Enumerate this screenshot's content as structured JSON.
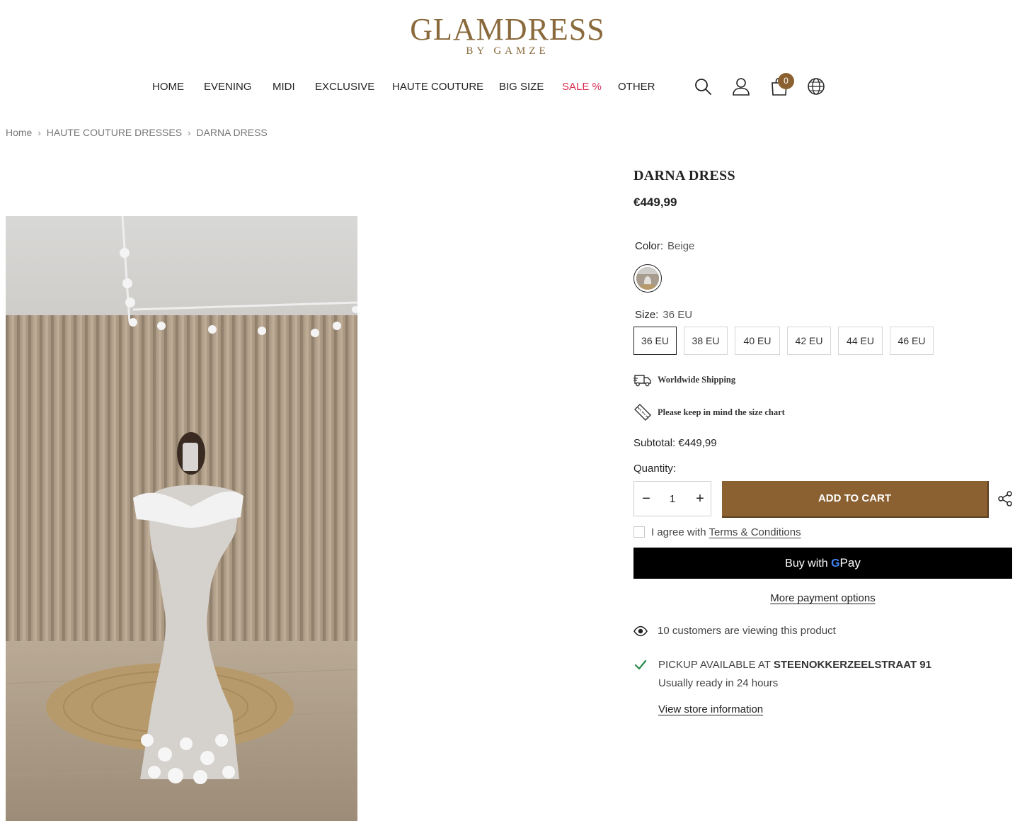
{
  "brand": {
    "name": "GLAMDRESS",
    "tagline": "BY GAMZE",
    "color": "#8a6a3c"
  },
  "nav": [
    {
      "label": "HOME"
    },
    {
      "label": "EVENING"
    },
    {
      "label": "MIDI"
    },
    {
      "label": "EXCLUSIVE"
    },
    {
      "label": "HAUTE COUTURE"
    },
    {
      "label": "BIG SIZE"
    },
    {
      "label": "SALE %",
      "color": "#d62d52"
    },
    {
      "label": "OTHER"
    }
  ],
  "header_icons": {
    "search": "search-icon",
    "account": "user-icon",
    "cart": "bag-icon",
    "language": "globe-icon",
    "cart_count": "0"
  },
  "breadcrumb": [
    "Home",
    "HAUTE COUTURE DRESSES",
    "DARNA DRESS"
  ],
  "product": {
    "title": "DARNA DRESS",
    "price": "€449,99",
    "color_label": "Color:",
    "color_value": "Beige",
    "size_label": "Size:",
    "size_value": "36 EU",
    "sizes": [
      "36 EU",
      "38 EU",
      "40 EU",
      "42 EU",
      "44 EU",
      "46 EU"
    ],
    "selected_size": "36 EU",
    "shipping_text": "Worldwide Shipping",
    "size_chart_text": "Please keep in mind the size chart",
    "subtotal_label": "Subtotal:",
    "subtotal_value": "€449,99",
    "quantity_label": "Quantity:",
    "quantity": "1",
    "add_to_cart": "ADD TO CART",
    "agree_text": "I agree with",
    "terms_link": "Terms & Conditions",
    "gpay_prefix": "Buy with",
    "gpay_g": "G",
    "gpay_pay": "Pay",
    "more_payment": "More payment options",
    "viewing_text": "10 customers are viewing this product",
    "pickup_prefix": "PICKUP AVAILABLE AT",
    "pickup_location": "STEENOKKERZEELSTRAAT 91",
    "pickup_ready": "Usually ready in 24 hours",
    "store_info_link": "View store information"
  },
  "accent_color": "#8b6131"
}
